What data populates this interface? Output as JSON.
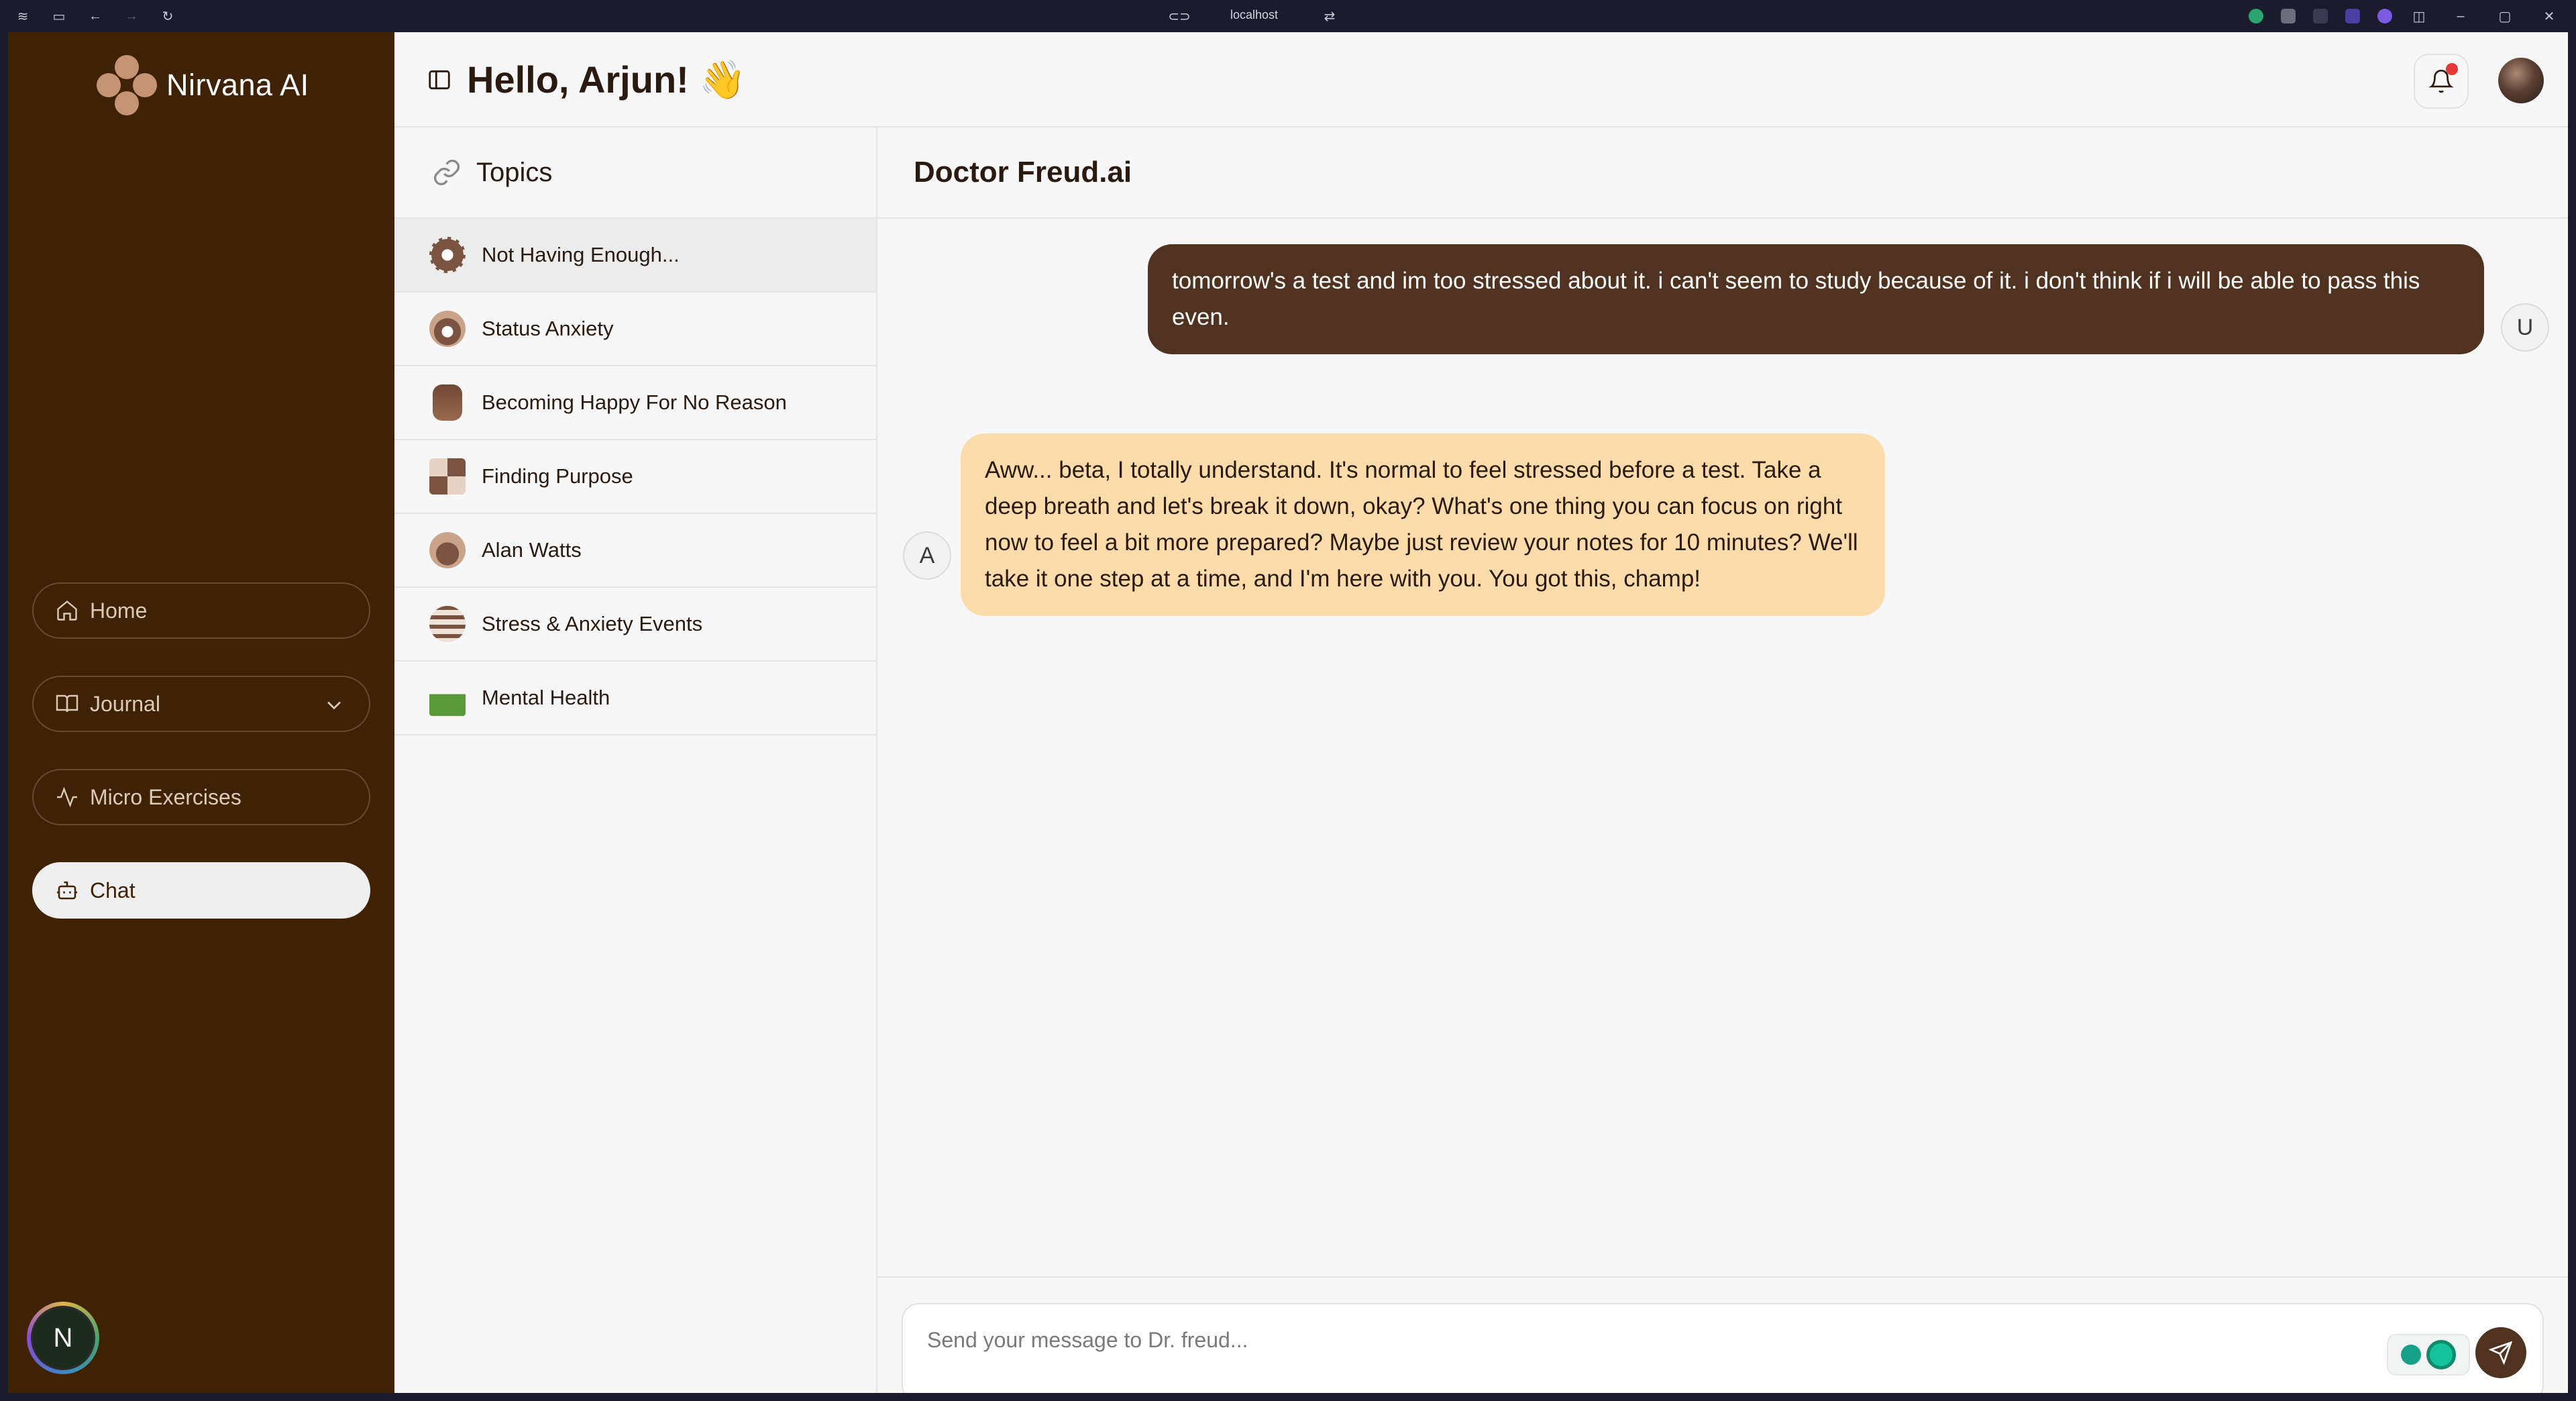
{
  "browser": {
    "url": "localhost"
  },
  "brand": {
    "name": "Nirvana AI"
  },
  "sidebar": {
    "items": [
      {
        "label": "Home",
        "icon": "home-icon"
      },
      {
        "label": "Journal",
        "icon": "book-icon"
      },
      {
        "label": "Micro Exercises",
        "icon": "activity-icon"
      },
      {
        "label": "Chat",
        "icon": "bot-icon"
      }
    ],
    "user_initial": "N"
  },
  "header": {
    "greeting": "Hello, Arjun! 👋"
  },
  "topics": {
    "title": "Topics",
    "items": [
      {
        "label": "Not Having Enough..."
      },
      {
        "label": "Status Anxiety"
      },
      {
        "label": "Becoming Happy For No Reason"
      },
      {
        "label": "Finding Purpose"
      },
      {
        "label": "Alan Watts"
      },
      {
        "label": "Stress & Anxiety Events"
      },
      {
        "label": "Mental Health"
      }
    ]
  },
  "chat": {
    "title": "Doctor Freud.ai",
    "messages": [
      {
        "role": "user",
        "avatar": "U",
        "text": "tomorrow's a test and im too stressed about it. i can't seem to study because of it. i don't think if i will be able to pass this even."
      },
      {
        "role": "assistant",
        "avatar": "A",
        "text": "Aww... beta, I totally understand. It's normal to feel stressed before a test. Take a deep breath and let's break it down, okay? What's one thing you can focus on right now to feel a bit more prepared? Maybe just review your notes for 10 minutes? We'll take it one step at a time, and I'm here with you. You got this, champ!"
      }
    ],
    "input_placeholder": "Send your message to Dr. freud...",
    "input_value": ""
  },
  "colors": {
    "sidebar_bg": "#3f2204",
    "user_bubble": "#4f321f",
    "ai_bubble": "#fcdcab",
    "accent": "#4f321f"
  }
}
